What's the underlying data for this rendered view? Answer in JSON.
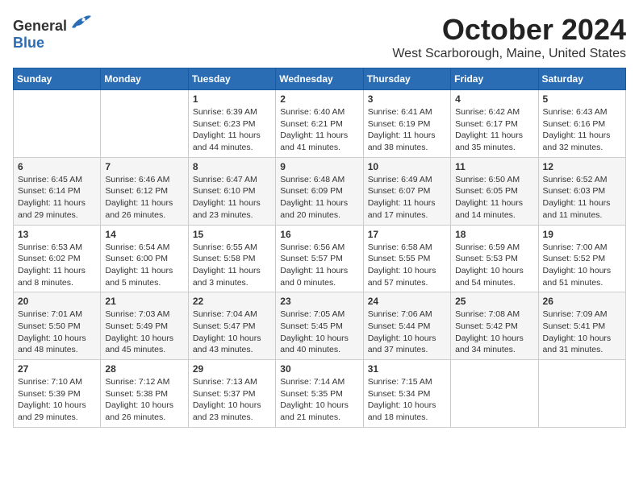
{
  "header": {
    "logo_general": "General",
    "logo_blue": "Blue",
    "month_title": "October 2024",
    "location": "West Scarborough, Maine, United States"
  },
  "days_of_week": [
    "Sunday",
    "Monday",
    "Tuesday",
    "Wednesday",
    "Thursday",
    "Friday",
    "Saturday"
  ],
  "weeks": [
    [
      {
        "day": "",
        "info": ""
      },
      {
        "day": "",
        "info": ""
      },
      {
        "day": "1",
        "info": "Sunrise: 6:39 AM\nSunset: 6:23 PM\nDaylight: 11 hours and 44 minutes."
      },
      {
        "day": "2",
        "info": "Sunrise: 6:40 AM\nSunset: 6:21 PM\nDaylight: 11 hours and 41 minutes."
      },
      {
        "day": "3",
        "info": "Sunrise: 6:41 AM\nSunset: 6:19 PM\nDaylight: 11 hours and 38 minutes."
      },
      {
        "day": "4",
        "info": "Sunrise: 6:42 AM\nSunset: 6:17 PM\nDaylight: 11 hours and 35 minutes."
      },
      {
        "day": "5",
        "info": "Sunrise: 6:43 AM\nSunset: 6:16 PM\nDaylight: 11 hours and 32 minutes."
      }
    ],
    [
      {
        "day": "6",
        "info": "Sunrise: 6:45 AM\nSunset: 6:14 PM\nDaylight: 11 hours and 29 minutes."
      },
      {
        "day": "7",
        "info": "Sunrise: 6:46 AM\nSunset: 6:12 PM\nDaylight: 11 hours and 26 minutes."
      },
      {
        "day": "8",
        "info": "Sunrise: 6:47 AM\nSunset: 6:10 PM\nDaylight: 11 hours and 23 minutes."
      },
      {
        "day": "9",
        "info": "Sunrise: 6:48 AM\nSunset: 6:09 PM\nDaylight: 11 hours and 20 minutes."
      },
      {
        "day": "10",
        "info": "Sunrise: 6:49 AM\nSunset: 6:07 PM\nDaylight: 11 hours and 17 minutes."
      },
      {
        "day": "11",
        "info": "Sunrise: 6:50 AM\nSunset: 6:05 PM\nDaylight: 11 hours and 14 minutes."
      },
      {
        "day": "12",
        "info": "Sunrise: 6:52 AM\nSunset: 6:03 PM\nDaylight: 11 hours and 11 minutes."
      }
    ],
    [
      {
        "day": "13",
        "info": "Sunrise: 6:53 AM\nSunset: 6:02 PM\nDaylight: 11 hours and 8 minutes."
      },
      {
        "day": "14",
        "info": "Sunrise: 6:54 AM\nSunset: 6:00 PM\nDaylight: 11 hours and 5 minutes."
      },
      {
        "day": "15",
        "info": "Sunrise: 6:55 AM\nSunset: 5:58 PM\nDaylight: 11 hours and 3 minutes."
      },
      {
        "day": "16",
        "info": "Sunrise: 6:56 AM\nSunset: 5:57 PM\nDaylight: 11 hours and 0 minutes."
      },
      {
        "day": "17",
        "info": "Sunrise: 6:58 AM\nSunset: 5:55 PM\nDaylight: 10 hours and 57 minutes."
      },
      {
        "day": "18",
        "info": "Sunrise: 6:59 AM\nSunset: 5:53 PM\nDaylight: 10 hours and 54 minutes."
      },
      {
        "day": "19",
        "info": "Sunrise: 7:00 AM\nSunset: 5:52 PM\nDaylight: 10 hours and 51 minutes."
      }
    ],
    [
      {
        "day": "20",
        "info": "Sunrise: 7:01 AM\nSunset: 5:50 PM\nDaylight: 10 hours and 48 minutes."
      },
      {
        "day": "21",
        "info": "Sunrise: 7:03 AM\nSunset: 5:49 PM\nDaylight: 10 hours and 45 minutes."
      },
      {
        "day": "22",
        "info": "Sunrise: 7:04 AM\nSunset: 5:47 PM\nDaylight: 10 hours and 43 minutes."
      },
      {
        "day": "23",
        "info": "Sunrise: 7:05 AM\nSunset: 5:45 PM\nDaylight: 10 hours and 40 minutes."
      },
      {
        "day": "24",
        "info": "Sunrise: 7:06 AM\nSunset: 5:44 PM\nDaylight: 10 hours and 37 minutes."
      },
      {
        "day": "25",
        "info": "Sunrise: 7:08 AM\nSunset: 5:42 PM\nDaylight: 10 hours and 34 minutes."
      },
      {
        "day": "26",
        "info": "Sunrise: 7:09 AM\nSunset: 5:41 PM\nDaylight: 10 hours and 31 minutes."
      }
    ],
    [
      {
        "day": "27",
        "info": "Sunrise: 7:10 AM\nSunset: 5:39 PM\nDaylight: 10 hours and 29 minutes."
      },
      {
        "day": "28",
        "info": "Sunrise: 7:12 AM\nSunset: 5:38 PM\nDaylight: 10 hours and 26 minutes."
      },
      {
        "day": "29",
        "info": "Sunrise: 7:13 AM\nSunset: 5:37 PM\nDaylight: 10 hours and 23 minutes."
      },
      {
        "day": "30",
        "info": "Sunrise: 7:14 AM\nSunset: 5:35 PM\nDaylight: 10 hours and 21 minutes."
      },
      {
        "day": "31",
        "info": "Sunrise: 7:15 AM\nSunset: 5:34 PM\nDaylight: 10 hours and 18 minutes."
      },
      {
        "day": "",
        "info": ""
      },
      {
        "day": "",
        "info": ""
      }
    ]
  ]
}
